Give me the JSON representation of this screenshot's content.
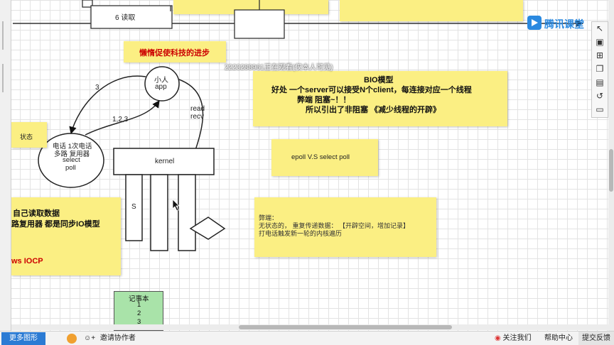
{
  "canvas": {
    "top_box_label": "6 读取",
    "orange_note": "懒惰促使科技的进步",
    "arrow_3_label": "3",
    "arrow_123_label": "1,2,3",
    "xiaoren": [
      "小人",
      "app"
    ],
    "read_recv": [
      "read",
      "recv"
    ],
    "phone_circle": [
      "电话  1次电话",
      "多路  复用器",
      "select",
      "poll"
    ],
    "left_note_status": "状态",
    "kernel_label": "kernel",
    "s_label": "S",
    "bio_note": {
      "title": "BIO模型",
      "line1": "好处   一个server可以接受N个client，每连接对应一个线程",
      "line2": "弊端    阻塞~！！",
      "line3": "所以引出了非阻塞 《减少线程的开辟》"
    },
    "epoll_note": "epoll  V.S  select poll",
    "drawback_note": {
      "line1": "弊端：",
      "line2": "无状态的，  重复传递数据：  【开辟空间，增加记录】",
      "line3": "打电话触发新一轮的内核遍历"
    },
    "left_note": {
      "line1": "自己读取数据",
      "line2": "路复用器  都是同步IO模型",
      "line3": "ws  IOCP"
    },
    "notebook": {
      "title": "记事本",
      "items": [
        "1",
        "2",
        "3"
      ]
    },
    "watermark": "2223288961正在观看(仅本人可见)"
  },
  "logo": {
    "text": "腾讯课堂",
    "icon": "tencent-classroom-logo"
  },
  "bottombar": {
    "more_shapes": "更多图形",
    "invite": "邀请协作者",
    "follow": "关注我们",
    "help": "帮助中心",
    "feedback": "提交反馈"
  },
  "right_toolbar": {
    "icons": [
      "cursor-icon",
      "image-icon",
      "plus-square-icon",
      "document-icon",
      "page-icon",
      "format-icon",
      "history-icon",
      "comment-icon"
    ]
  },
  "colors": {
    "sticky": "#fbef83",
    "notebook": "#a9e3a9",
    "accent_red": "#cc0000",
    "brand_blue": "#2a89e0"
  }
}
